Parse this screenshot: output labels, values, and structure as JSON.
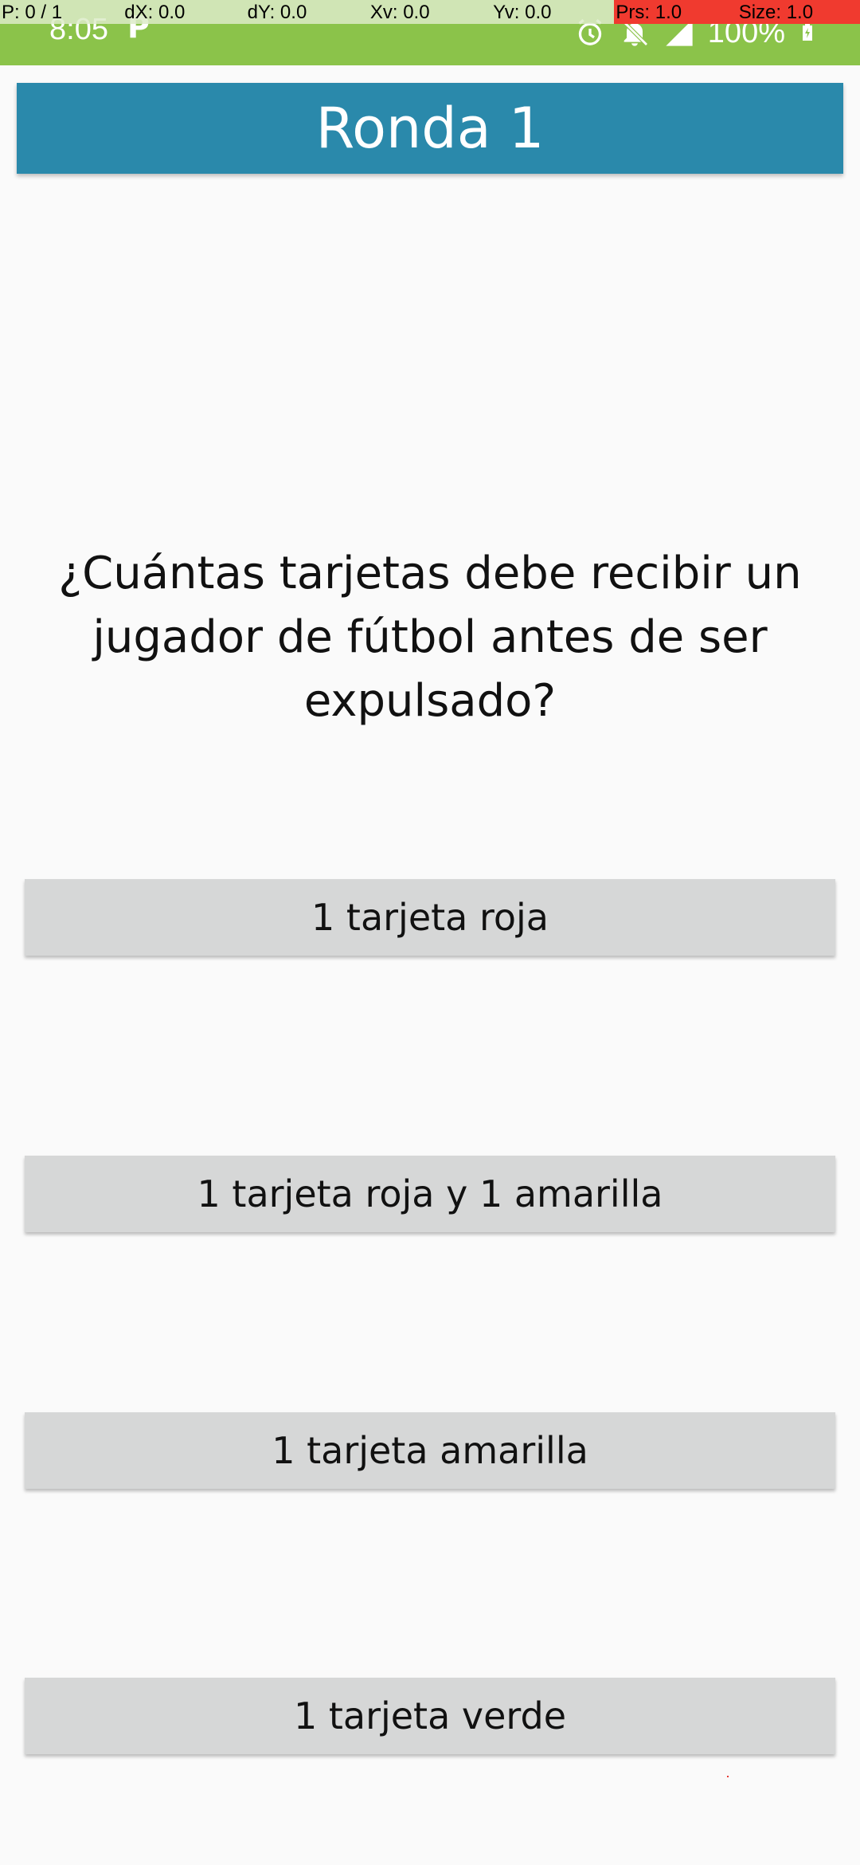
{
  "status_bar": {
    "time": "8:05",
    "app_icon": "P",
    "icons": [
      "alarm-icon",
      "notifications-off-icon",
      "signal-icon"
    ],
    "battery_text": "100%"
  },
  "debug_overlay": {
    "pointer": "P: 0 / 1",
    "dx": "dX: 0.0",
    "dy": "dY: 0.0",
    "xv": "Xv: 0.0",
    "yv": "Yv: 0.0",
    "prs": "Prs: 1.0",
    "size": "Size: 1.0"
  },
  "header": {
    "title": "Ronda 1"
  },
  "question": "¿Cuántas tarjetas debe recibir un jugador de fútbol antes de ser expulsado?",
  "answers": [
    "1 tarjeta roja",
    "1 tarjeta roja y 1 amarilla",
    "1 tarjeta amarilla",
    "1 tarjeta verde"
  ],
  "colors": {
    "status_bar": "#8bc34a",
    "header": "#2a89ab",
    "button": "#d6d7d7",
    "background": "#fafafa"
  }
}
